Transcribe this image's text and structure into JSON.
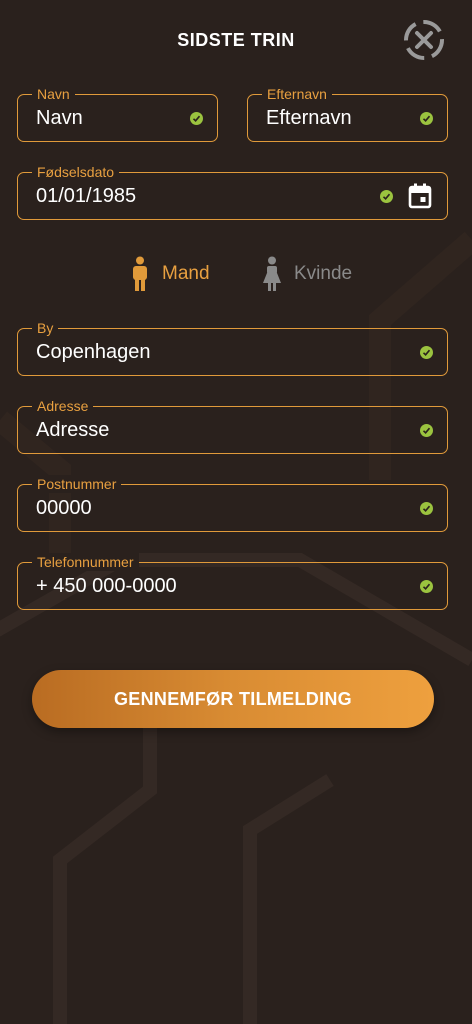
{
  "header": {
    "title": "SIDSTE TRIN"
  },
  "fields": {
    "navn": {
      "label": "Navn",
      "value": "Navn"
    },
    "efternavn": {
      "label": "Efternavn",
      "value": "Efternavn"
    },
    "fodselsdato": {
      "label": "Fødselsdato",
      "value": "01/01/1985"
    },
    "by": {
      "label": "By",
      "value": "Copenhagen"
    },
    "adresse": {
      "label": "Adresse",
      "value": "Adresse"
    },
    "postnummer": {
      "label": "Postnummer",
      "value": "00000"
    },
    "telefonnummer": {
      "label": "Telefonnummer",
      "value": "+ 450 000-0000"
    }
  },
  "gender": {
    "male_label": "Mand",
    "female_label": "Kvinde",
    "selected": "male"
  },
  "submit": {
    "label": "GENNEMFØR TILMELDING"
  },
  "colors": {
    "background": "#2a211d",
    "accent": "#e09a3a",
    "valid": "#9bc33f",
    "inactive": "#8a8a8a"
  },
  "icons": [
    "close-icon",
    "check-icon",
    "calendar-icon",
    "male-icon",
    "female-icon"
  ]
}
